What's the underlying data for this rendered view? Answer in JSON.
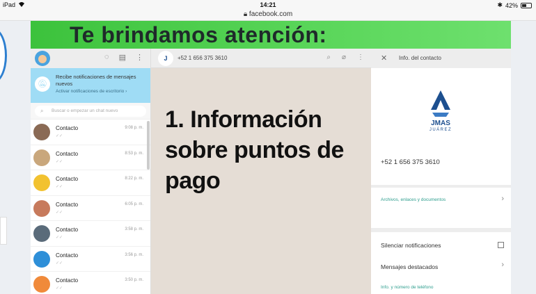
{
  "statusbar": {
    "device": "iPad",
    "time": "14:21",
    "battery": "42%",
    "battery_level": 0.42
  },
  "browser": {
    "url": "facebook.com"
  },
  "banner": {
    "title": "Te brindamos atención:"
  },
  "whatsapp": {
    "notification": {
      "title": "Recibe notificaciones de mensajes nuevos",
      "action": "Activar notificaciones de escritorio ›"
    },
    "search_placeholder": "Buscar o empezar un chat nuevo",
    "chats": [
      {
        "name": "Contacto",
        "time": "9:08 p. m.",
        "tick": "✓✓",
        "avatar_color": "#8a6a55"
      },
      {
        "name": "Contacto",
        "time": "8:53 p. m.",
        "tick": "✓✓",
        "avatar_color": "#c9a77c"
      },
      {
        "name": "Contacto",
        "time": "8:22 p. m.",
        "tick": "✓✓",
        "avatar_color": "#f2c230"
      },
      {
        "name": "Contacto",
        "time": "6:05 p. m.",
        "tick": "✓✓",
        "avatar_color": "#c77a5c"
      },
      {
        "name": "Contacto",
        "time": "3:58 p. m.",
        "tick": "✓✓",
        "avatar_color": "#5a6b7a"
      },
      {
        "name": "Contacto",
        "time": "3:56 p. m.",
        "tick": "✓✓",
        "avatar_color": "#2e8fd8"
      },
      {
        "name": "Contacto",
        "time": "3:50 p. m.",
        "tick": "✓✓",
        "avatar_color": "#f08a3a"
      }
    ],
    "chat_header": {
      "number": "+52 1 656 375 3610",
      "logo_text": "J"
    },
    "overlay_text": "1. Información sobre puntos de pago",
    "info": {
      "title": "Info. del contacto",
      "org_name": "JMAS",
      "org_sub": "JUÁREZ",
      "phone": "+52 1 656 375 3610",
      "files": "Archivos, enlaces y documentos",
      "mute": "Silenciar notificaciones",
      "starred": "Mensajes destacados",
      "info_phone": "Info. y número de teléfono"
    }
  }
}
